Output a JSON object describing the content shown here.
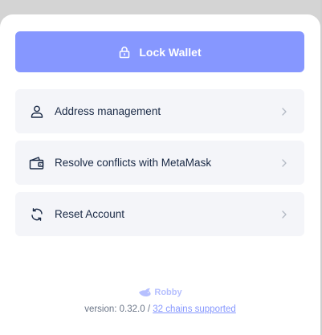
{
  "lock_button": {
    "label": "Lock Wallet",
    "icon": "lock-icon"
  },
  "menu": [
    {
      "label": "Address management",
      "icon": "user-icon"
    },
    {
      "label": "Resolve conflicts with MetaMask",
      "icon": "wallet-icon"
    },
    {
      "label": "Reset Account",
      "icon": "refresh-icon"
    }
  ],
  "footer": {
    "brand": "Robby",
    "version_prefix": "version: 0.32.0 / ",
    "chains_link": "32 chains supported"
  },
  "colors": {
    "accent": "#8697ff",
    "row_bg": "#f4f5f9",
    "text": "#192945",
    "muted": "#6a7587"
  }
}
